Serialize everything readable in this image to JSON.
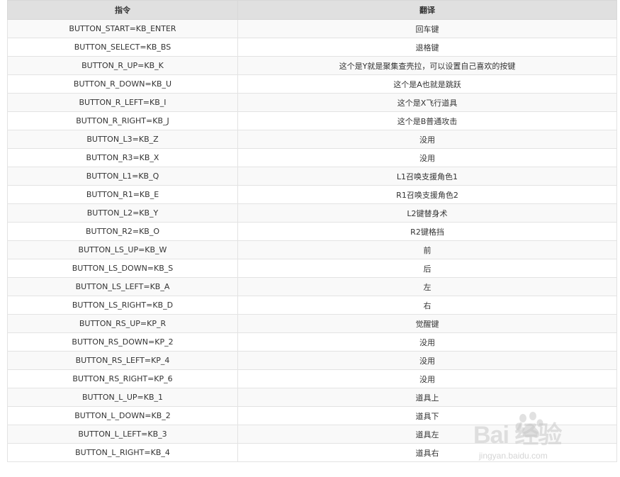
{
  "table": {
    "headers": [
      "指令",
      "翻译"
    ],
    "rows": [
      {
        "cmd": "BUTTON_START=KB_ENTER",
        "desc": "回车键"
      },
      {
        "cmd": "BUTTON_SELECT=KB_BS",
        "desc": "退格键"
      },
      {
        "cmd": "BUTTON_R_UP=KB_K",
        "desc": "这个是Y就是聚集查壳拉，可以设置自己喜欢的按键"
      },
      {
        "cmd": "BUTTON_R_DOWN=KB_U",
        "desc": "这个是A也就是跳跃"
      },
      {
        "cmd": "BUTTON_R_LEFT=KB_I",
        "desc": "这个是X飞行道具"
      },
      {
        "cmd": "BUTTON_R_RIGHT=KB_J",
        "desc": "这个是B普通攻击"
      },
      {
        "cmd": "BUTTON_L3=KB_Z",
        "desc": "没用"
      },
      {
        "cmd": "BUTTON_R3=KB_X",
        "desc": "没用"
      },
      {
        "cmd": "BUTTON_L1=KB_Q",
        "desc": "L1召唤支援角色1"
      },
      {
        "cmd": "BUTTON_R1=KB_E",
        "desc": "R1召唤支援角色2"
      },
      {
        "cmd": "BUTTON_L2=KB_Y",
        "desc": "L2键替身术"
      },
      {
        "cmd": "BUTTON_R2=KB_O",
        "desc": "R2键格挡"
      },
      {
        "cmd": "BUTTON_LS_UP=KB_W",
        "desc": "前"
      },
      {
        "cmd": "BUTTON_LS_DOWN=KB_S",
        "desc": "后"
      },
      {
        "cmd": "BUTTON_LS_LEFT=KB_A",
        "desc": "左"
      },
      {
        "cmd": "BUTTON_LS_RIGHT=KB_D",
        "desc": "右"
      },
      {
        "cmd": "BUTTON_RS_UP=KP_R",
        "desc": "觉醒键"
      },
      {
        "cmd": "BUTTON_RS_DOWN=KP_2",
        "desc": "没用"
      },
      {
        "cmd": "BUTTON_RS_LEFT=KP_4",
        "desc": "没用"
      },
      {
        "cmd": "BUTTON_RS_RIGHT=KP_6",
        "desc": "没用"
      },
      {
        "cmd": "BUTTON_L_UP=KB_1",
        "desc": "道具上"
      },
      {
        "cmd": "BUTTON_L_DOWN=KB_2",
        "desc": "道具下"
      },
      {
        "cmd": "BUTTON_L_LEFT=KB_3",
        "desc": "道具左"
      },
      {
        "cmd": "BUTTON_L_RIGHT=KB_4",
        "desc": "道具右"
      }
    ]
  },
  "watermark": {
    "brand": "Bai 经验",
    "site": "jingyan.baidu.com",
    "icon": "baidu-paw-icon"
  },
  "colors": {
    "header_bg": "#e0e0e0",
    "row_alt_bg": "#f9f9f9",
    "border": "#e3e3e3",
    "text": "#333333"
  }
}
